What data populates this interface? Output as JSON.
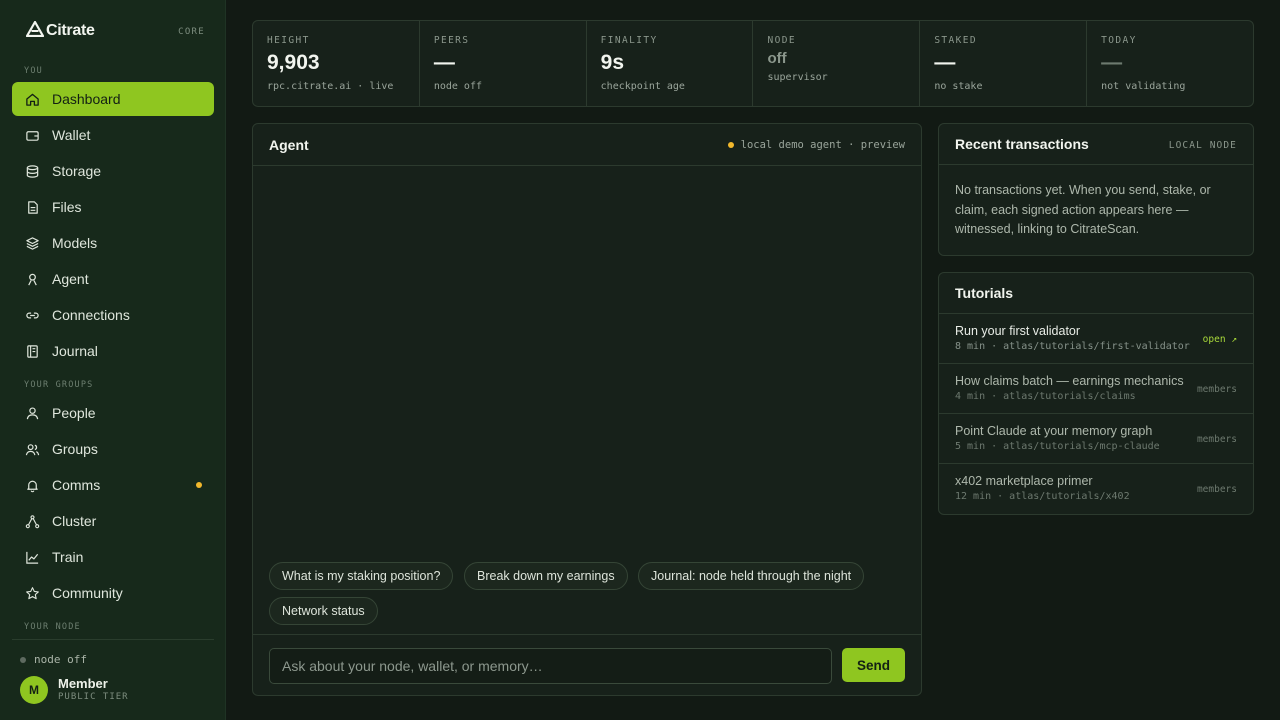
{
  "brand": {
    "name": "Citrate",
    "tag": "CORE"
  },
  "sidebar": {
    "sections": {
      "you": "YOU",
      "groups": "YOUR GROUPS",
      "node": "YOUR NODE"
    },
    "items": [
      {
        "label": "Dashboard",
        "icon": "home-icon"
      },
      {
        "label": "Wallet",
        "icon": "wallet-icon"
      },
      {
        "label": "Storage",
        "icon": "database-icon"
      },
      {
        "label": "Files",
        "icon": "file-icon"
      },
      {
        "label": "Models",
        "icon": "layers-icon"
      },
      {
        "label": "Agent",
        "icon": "agent-icon"
      },
      {
        "label": "Connections",
        "icon": "link-icon"
      },
      {
        "label": "Journal",
        "icon": "journal-icon"
      },
      {
        "label": "People",
        "icon": "person-icon"
      },
      {
        "label": "Groups",
        "icon": "users-icon"
      },
      {
        "label": "Comms",
        "icon": "bell-icon"
      },
      {
        "label": "Cluster",
        "icon": "cluster-icon"
      },
      {
        "label": "Train",
        "icon": "chart-line-icon"
      },
      {
        "label": "Community",
        "icon": "star-icon"
      }
    ],
    "node_status": "node off",
    "user": {
      "initial": "M",
      "name": "Member",
      "tier": "PUBLIC TIER"
    }
  },
  "stats": [
    {
      "label": "HEIGHT",
      "value": "9,903",
      "sub": "rpc.citrate.ai · live"
    },
    {
      "label": "PEERS",
      "value": "—",
      "sub": "node off"
    },
    {
      "label": "FINALITY",
      "value": "9s",
      "sub": "checkpoint age"
    },
    {
      "label": "NODE",
      "value": "off",
      "sub": "supervisor"
    },
    {
      "label": "STAKED",
      "value": "—",
      "sub": "no stake"
    },
    {
      "label": "TODAY",
      "value": "—",
      "sub": "not validating"
    }
  ],
  "agent": {
    "title": "Agent",
    "status": "local demo agent · preview",
    "suggestions": [
      "What is my staking position?",
      "Break down my earnings",
      "Journal: node held through the night",
      "Network status"
    ],
    "input_placeholder": "Ask about your node, wallet, or memory…",
    "send_label": "Send"
  },
  "transactions": {
    "title": "Recent transactions",
    "tag": "LOCAL NODE",
    "empty": "No transactions yet. When you send, stake, or claim, each signed action appears here — witnessed, linking to CitrateScan."
  },
  "tutorials": {
    "title": "Tutorials",
    "items": [
      {
        "title": "Run your first validator",
        "meta": "8 min · atlas/tutorials/first-validator",
        "action": "open ↗"
      },
      {
        "title": "How claims batch — earnings mechanics",
        "meta": "4 min · atlas/tutorials/claims",
        "action": "members"
      },
      {
        "title": "Point Claude at your memory graph",
        "meta": "5 min · atlas/tutorials/mcp-claude",
        "action": "members"
      },
      {
        "title": "x402 marketplace primer",
        "meta": "12 min · atlas/tutorials/x402",
        "action": "members"
      }
    ]
  },
  "colors": {
    "accent": "#8fc620",
    "warning": "#f2b82c",
    "background": "#121a14",
    "sidebar": "#17291b"
  }
}
